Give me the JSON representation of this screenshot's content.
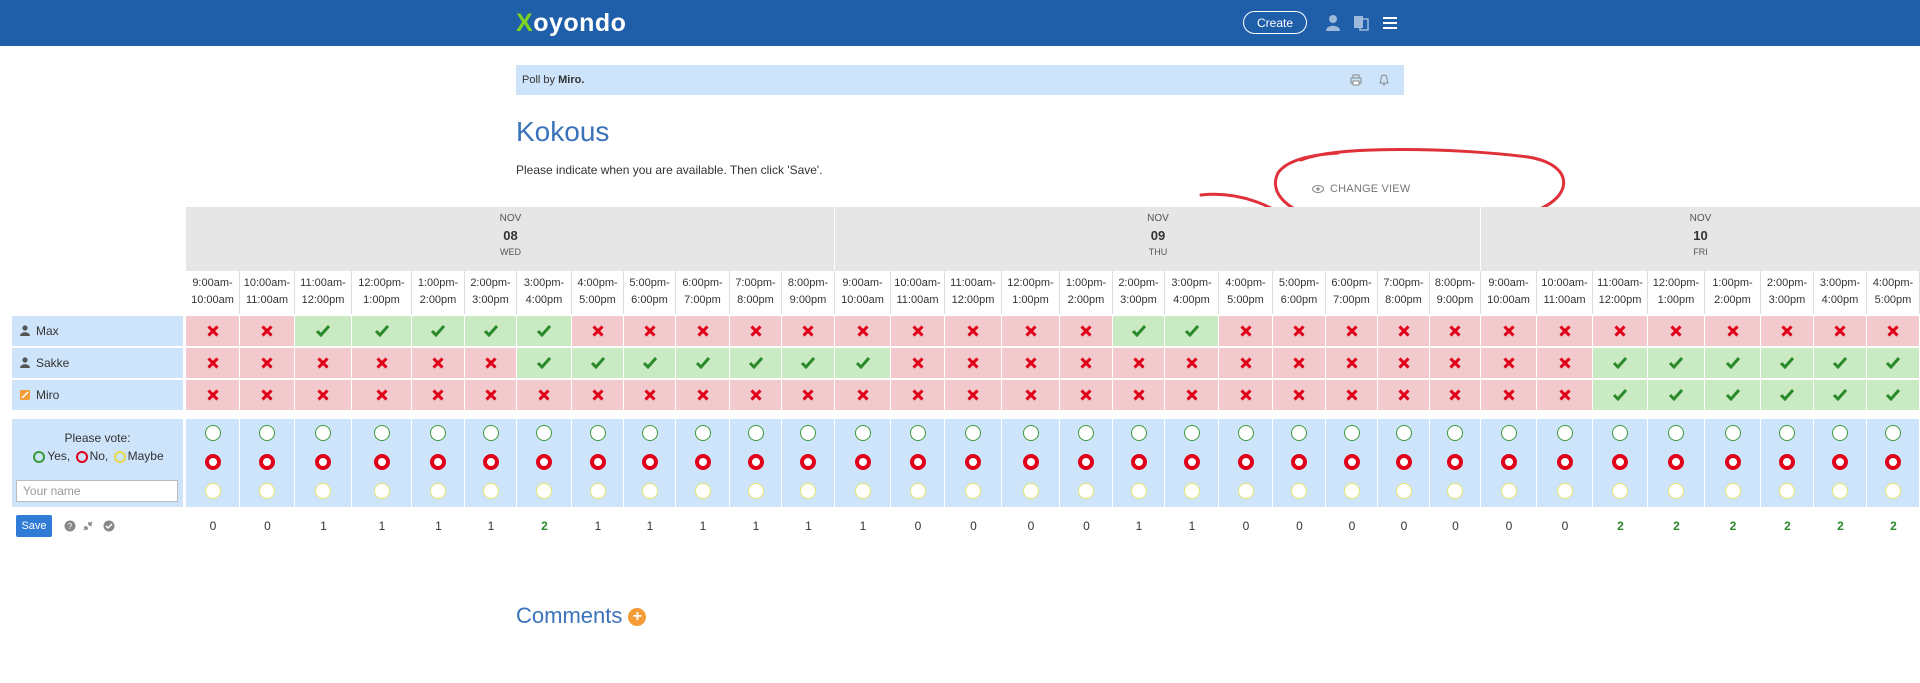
{
  "brand": {
    "logo_x": "X",
    "logo_rest": "oyondo"
  },
  "header": {
    "create_label": "Create"
  },
  "pollby": {
    "prefix": "Poll by",
    "author": "Miro."
  },
  "poll": {
    "title": "Kokous",
    "description": "Please indicate when you are available. Then click 'Save'.",
    "change_view": "CHANGE VIEW"
  },
  "days": [
    {
      "month": "NOV",
      "day": "08",
      "weekday": "WED"
    },
    {
      "month": "NOV",
      "day": "09",
      "weekday": "THU"
    },
    {
      "month": "NOV",
      "day": "10",
      "weekday": "FRI"
    }
  ],
  "slots": [
    [
      "9:00am-",
      "10:00am"
    ],
    [
      "10:00am-",
      "11:00am"
    ],
    [
      "11:00am-",
      "12:00pm"
    ],
    [
      "12:00pm-",
      "1:00pm"
    ],
    [
      "1:00pm-",
      "2:00pm"
    ],
    [
      "2:00pm-",
      "3:00pm"
    ],
    [
      "3:00pm-",
      "4:00pm"
    ],
    [
      "4:00pm-",
      "5:00pm"
    ],
    [
      "5:00pm-",
      "6:00pm"
    ],
    [
      "6:00pm-",
      "7:00pm"
    ],
    [
      "7:00pm-",
      "8:00pm"
    ],
    [
      "8:00pm-",
      "9:00pm"
    ],
    [
      "9:00am-",
      "10:00am"
    ],
    [
      "10:00am-",
      "11:00am"
    ],
    [
      "11:00am-",
      "12:00pm"
    ],
    [
      "12:00pm-",
      "1:00pm"
    ],
    [
      "1:00pm-",
      "2:00pm"
    ],
    [
      "2:00pm-",
      "3:00pm"
    ],
    [
      "3:00pm-",
      "4:00pm"
    ],
    [
      "4:00pm-",
      "5:00pm"
    ],
    [
      "5:00pm-",
      "6:00pm"
    ],
    [
      "6:00pm-",
      "7:00pm"
    ],
    [
      "7:00pm-",
      "8:00pm"
    ],
    [
      "8:00pm-",
      "9:00pm"
    ],
    [
      "9:00am-",
      "10:00am"
    ],
    [
      "10:00am-",
      "11:00am"
    ],
    [
      "11:00am-",
      "12:00pm"
    ],
    [
      "12:00pm-",
      "1:00pm"
    ],
    [
      "1:00pm-",
      "2:00pm"
    ],
    [
      "2:00pm-",
      "3:00pm"
    ],
    [
      "3:00pm-",
      "4:00pm"
    ],
    [
      "4:00pm-",
      "5:00pm"
    ]
  ],
  "participants": [
    {
      "name": "Max",
      "icon": "user-icon",
      "votes": "NNYYYYYNNNNNNNNNNYYNNNNNNNNNNNNN"
    },
    {
      "name": "Sakke",
      "icon": "user-icon",
      "votes": "NNNNNNYYYYYYYNNNNNNNNNNNNNYYYYYY"
    },
    {
      "name": "Miro",
      "icon": "edit-icon",
      "votes": "NNNNNNNNNNNNNNNNNNNNNNNNNNYYYYYY"
    }
  ],
  "vote_form": {
    "label": "Please vote:",
    "legend_yes": "Yes,",
    "legend_no": "No,",
    "legend_maybe": "Maybe",
    "name_placeholder": "Your name",
    "row_letters": [
      "Y",
      "N",
      "M"
    ],
    "save_label": "Save"
  },
  "counts": [
    0,
    0,
    1,
    1,
    1,
    1,
    2,
    1,
    1,
    1,
    1,
    1,
    1,
    0,
    0,
    0,
    0,
    1,
    1,
    0,
    0,
    0,
    0,
    0,
    0,
    0,
    2,
    2,
    2,
    2,
    2,
    2
  ],
  "comments": {
    "title": "Comments"
  },
  "colors": {
    "topbar": "#1f5ea8",
    "yes": "#2a8a2a",
    "no": "#e0001a",
    "accent": "#3a73b9"
  }
}
